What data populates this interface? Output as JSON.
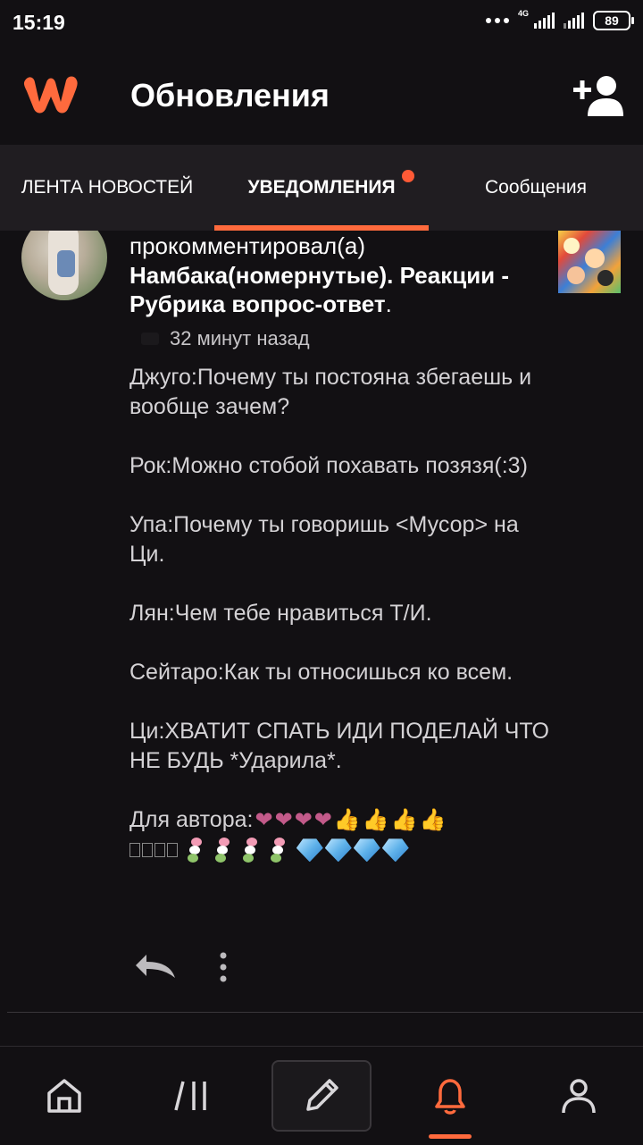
{
  "status_bar": {
    "time": "15:19",
    "network": "4G",
    "battery": "89"
  },
  "header": {
    "title": "Обновления"
  },
  "tabs": [
    {
      "label": "ЛЕНТА НОВОСТЕЙ"
    },
    {
      "label": "УВЕДОМЛЕНИЯ"
    },
    {
      "label": "Сообщения"
    }
  ],
  "notification": {
    "action": "прокомментировал(а)",
    "story_title": "Намбака(номернутые). Реакции - Рубрика вопрос-ответ",
    "title_end": ".",
    "time_ago": "32 минут назад",
    "comment_lines": [
      "Джуго:Почему ты постояна збегаешь и вообще зачем?",
      "Рок:Можно стобой похавать позязя(:3)",
      "Упа:Почему ты говоришь <Мусор> на Ци.",
      "Лян:Чем тебе нравиться Т/И.",
      "Сейтаро:Как ты относишься ко всем.",
      "Ци:ХВАТИТ СПАТЬ ИДИ ПОДЕЛАЙ ЧТО НЕ БУДЬ *Ударила*."
    ],
    "for_author_label": "Для автора:"
  },
  "icons": {
    "logo": "wattpad-logo-icon",
    "add_user": "add-user-icon",
    "reply": "reply-icon",
    "more": "more-vertical-icon",
    "home": "home-icon",
    "browse": "browse-icon",
    "write": "pencil-icon",
    "notifications": "bell-icon",
    "profile": "profile-icon"
  },
  "colors": {
    "accent": "#ff6a3d",
    "background": "#121013",
    "tabbar": "#201d21"
  }
}
